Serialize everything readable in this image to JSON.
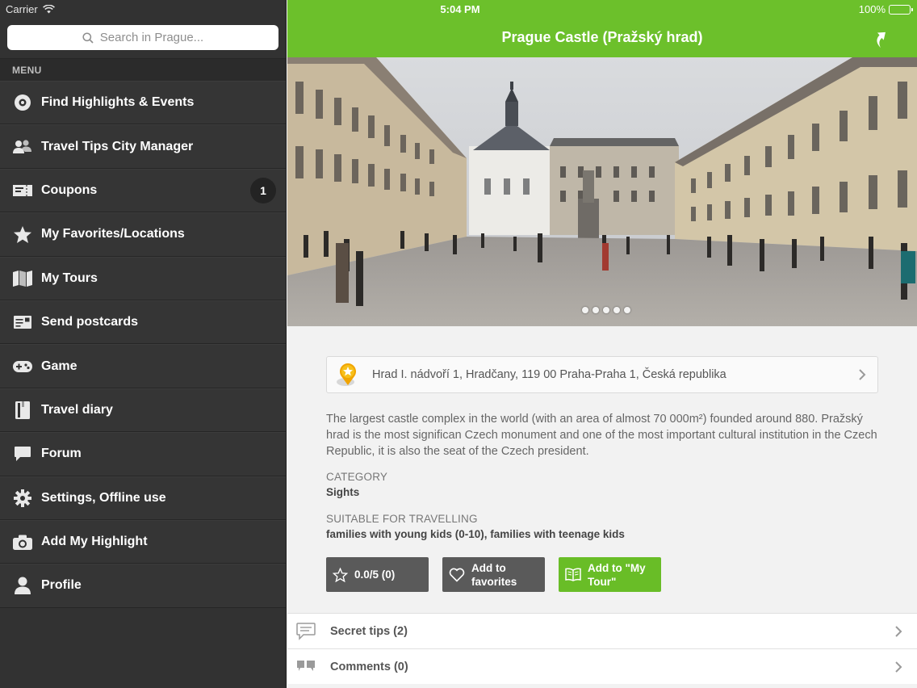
{
  "status": {
    "carrier": "Carrier",
    "time": "5:04 PM",
    "battery": "100%"
  },
  "search": {
    "placeholder": "Search in Prague..."
  },
  "menu": {
    "header": "MENU",
    "items": [
      {
        "label": "Find Highlights & Events",
        "icon": "target-icon"
      },
      {
        "label": "Travel Tips City Manager",
        "icon": "people-icon"
      },
      {
        "label": "Coupons",
        "icon": "coupon-icon",
        "badge": "1"
      },
      {
        "label": "My Favorites/Locations",
        "icon": "star-icon"
      },
      {
        "label": "My Tours",
        "icon": "map-icon"
      },
      {
        "label": "Send postcards",
        "icon": "postcard-icon"
      },
      {
        "label": "Game",
        "icon": "gamepad-icon"
      },
      {
        "label": "Travel diary",
        "icon": "diary-icon"
      },
      {
        "label": "Forum",
        "icon": "chat-icon"
      },
      {
        "label": "Settings, Offline use",
        "icon": "gear-icon"
      },
      {
        "label": "Add My Highlight",
        "icon": "camera-icon"
      },
      {
        "label": "Profile",
        "icon": "person-icon"
      }
    ]
  },
  "detail": {
    "title": "Prague Castle (Pražský hrad)",
    "gallery_pages": 5,
    "address": "Hrad I. nádvoří 1, Hradčany, 119 00 Praha-Praha 1, Česká republika",
    "description": "The largest castle complex in the world (with an area of almost 70 000m²) founded around 880. Pražský hrad is the most significan Czech monument and one of the most important cultural institution in the Czech Republic, it is also the seat of the Czech president.",
    "category_label": "CATEGORY",
    "category_value": "Sights",
    "suitable_label": "SUITABLE FOR TRAVELLING",
    "suitable_value": "families with young kids (0-10), families with teenage kids",
    "rating_button": "0.0/5 (0)",
    "favorites_button_line1": "Add to",
    "favorites_button_line2": "favorites",
    "tour_button_line1": "Add to \"My",
    "tour_button_line2": "Tour\"",
    "rows": [
      {
        "label": "Secret tips (2)",
        "icon": "speech-bubble-icon"
      },
      {
        "label": "Comments (0)",
        "icon": "comments-icon"
      }
    ]
  },
  "colors": {
    "accent_green": "#6cc02b",
    "sidebar_bg": "#323232",
    "button_dark": "#5a5a5a"
  }
}
